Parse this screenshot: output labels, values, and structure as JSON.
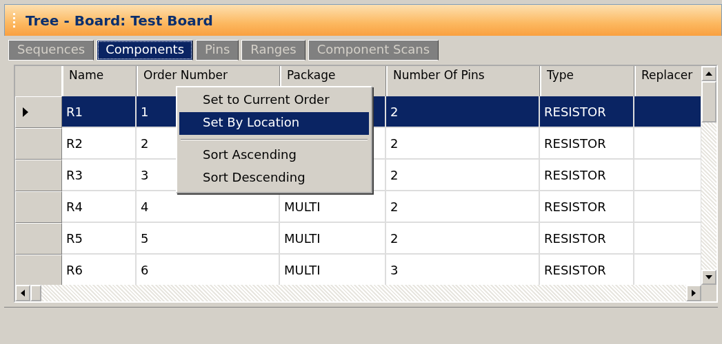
{
  "window": {
    "title": "Tree - Board: Test Board"
  },
  "tabs": [
    {
      "label": "Sequences",
      "selected": false
    },
    {
      "label": "Components",
      "selected": true
    },
    {
      "label": "Pins",
      "selected": false
    },
    {
      "label": "Ranges",
      "selected": false
    },
    {
      "label": "Component Scans",
      "selected": false
    }
  ],
  "table": {
    "columns": [
      "Name",
      "Order Number",
      "Package",
      "Number Of Pins",
      "Type",
      "Replacer"
    ],
    "rows": [
      {
        "selected": true,
        "cells": [
          "R1",
          "1",
          "",
          "2",
          "RESISTOR",
          ""
        ]
      },
      {
        "selected": false,
        "cells": [
          "R2",
          "2",
          "",
          "2",
          "RESISTOR",
          ""
        ]
      },
      {
        "selected": false,
        "cells": [
          "R3",
          "3",
          "",
          "2",
          "RESISTOR",
          ""
        ]
      },
      {
        "selected": false,
        "cells": [
          "R4",
          "4",
          "MULTI",
          "2",
          "RESISTOR",
          ""
        ]
      },
      {
        "selected": false,
        "cells": [
          "R5",
          "5",
          "MULTI",
          "2",
          "RESISTOR",
          ""
        ]
      },
      {
        "selected": false,
        "cells": [
          "R6",
          "6",
          "MULTI",
          "3",
          "RESISTOR",
          ""
        ]
      }
    ]
  },
  "context_menu": {
    "items": [
      {
        "kind": "item",
        "label": "Set to Current Order",
        "selected": false
      },
      {
        "kind": "item",
        "label": "Set By Location",
        "selected": true
      },
      {
        "kind": "separator"
      },
      {
        "kind": "item",
        "label": "Sort Ascending",
        "selected": false
      },
      {
        "kind": "item",
        "label": "Sort Descending",
        "selected": false
      }
    ]
  }
}
